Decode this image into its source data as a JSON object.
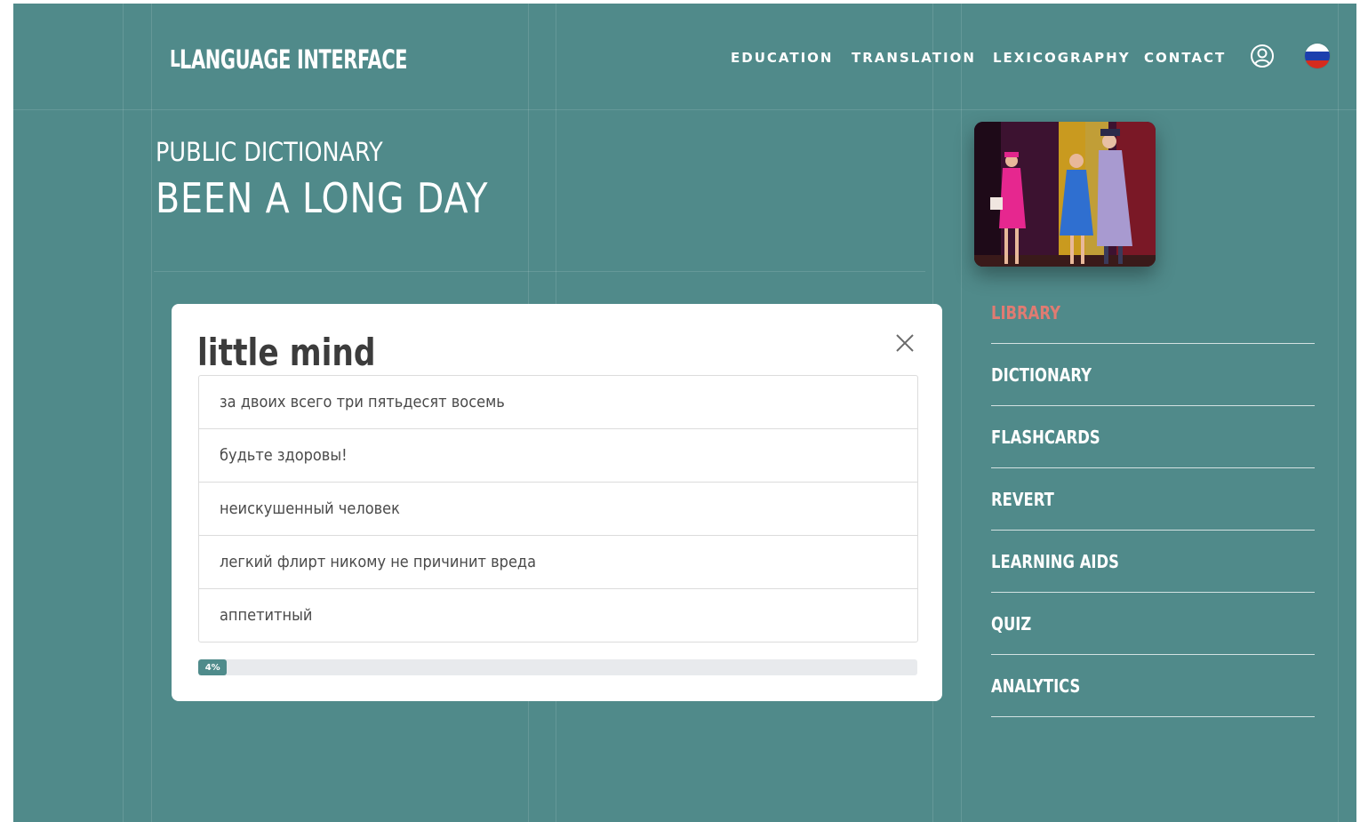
{
  "header": {
    "logo_mark": "L",
    "logo_text": "LANGUAGE INTERFACE",
    "nav": [
      {
        "label": "EDUCATION"
      },
      {
        "label": "TRANSLATION"
      },
      {
        "label": "LEXICOGRAPHY"
      },
      {
        "label": "CONTACT"
      }
    ],
    "user_icon": "user-circle-icon",
    "language_icon": "russian-flag-icon"
  },
  "page": {
    "kicker": "PUBLIC DICTIONARY",
    "title": "BEEN A LONG DAY"
  },
  "thumbnail": {
    "description_icon": "stage-performance-thumbnail"
  },
  "quiz": {
    "question": "little mind",
    "close_icon": "close-icon",
    "options": [
      {
        "text": "за двоих всего три пятьдесят восемь"
      },
      {
        "text": "будьте здоровы!"
      },
      {
        "text": "неискушенный человек"
      },
      {
        "text": "легкий флирт никому не причинит вреда"
      },
      {
        "text": "аппетитный"
      }
    ],
    "progress_label": "4%",
    "progress_percent": 4
  },
  "side_menu": {
    "items": [
      {
        "label": "LIBRARY",
        "active": true
      },
      {
        "label": "DICTIONARY",
        "active": false
      },
      {
        "label": "FLASHCARDS",
        "active": false
      },
      {
        "label": "REVERT",
        "active": false
      },
      {
        "label": "LEARNING AIDS",
        "active": false
      },
      {
        "label": "QUIZ",
        "active": false
      },
      {
        "label": "ANALYTICS",
        "active": false
      }
    ]
  },
  "colors": {
    "background": "#508a8a",
    "accent_active": "#e07b72",
    "progress_fill": "#4f8b8b"
  }
}
